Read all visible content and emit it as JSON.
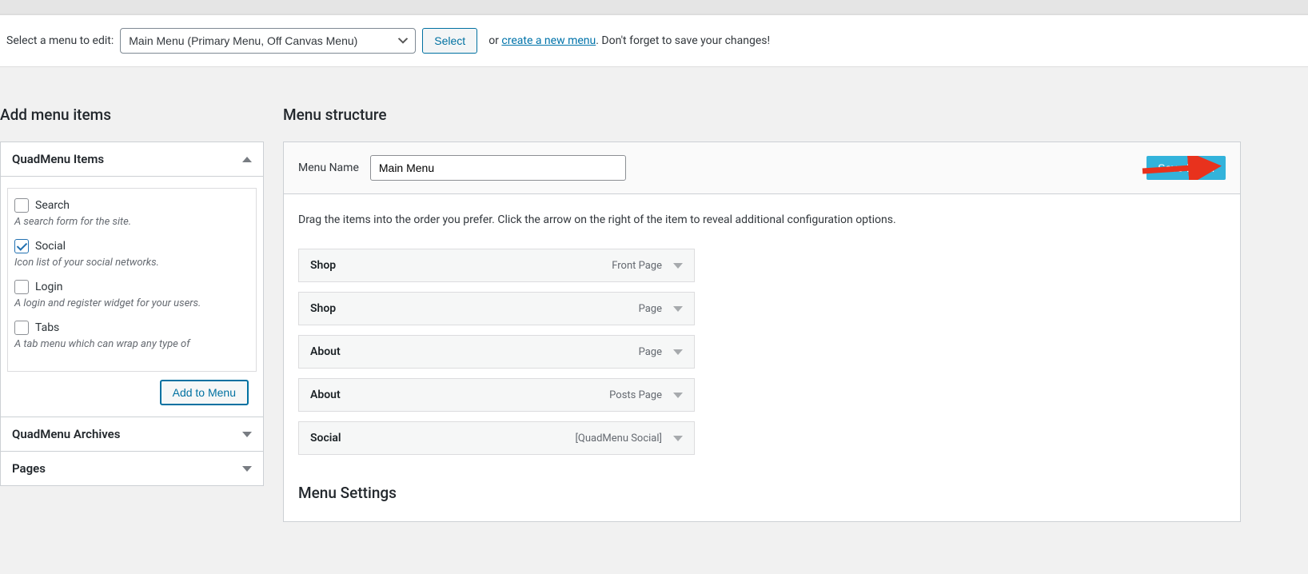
{
  "selectBar": {
    "label": "Select a menu to edit:",
    "selectedOption": "Main Menu (Primary Menu, Off Canvas Menu)",
    "selectButton": "Select",
    "orText": "or ",
    "createLink": "create a new menu",
    "tailText": ". Don't forget to save your changes!"
  },
  "leftPanel": {
    "heading": "Add menu items",
    "quadmenuItems": {
      "title": "QuadMenu Items",
      "items": [
        {
          "label": "Search",
          "desc": "A search form for the site.",
          "checked": false
        },
        {
          "label": "Social",
          "desc": "Icon list of your social networks.",
          "checked": true
        },
        {
          "label": "Login",
          "desc": "A login and register widget for your users.",
          "checked": false
        },
        {
          "label": "Tabs",
          "desc": "A tab menu which can wrap any type of",
          "checked": false
        }
      ],
      "addButton": "Add to Menu"
    },
    "archives": {
      "title": "QuadMenu Archives"
    },
    "pages": {
      "title": "Pages"
    }
  },
  "rightPanel": {
    "heading": "Menu structure",
    "menuNameLabel": "Menu Name",
    "menuNameValue": "Main Menu",
    "saveButton": "Save Menu",
    "dragHelp": "Drag the items into the order you prefer. Click the arrow on the right of the item to reveal additional configuration options.",
    "menuItems": [
      {
        "title": "Shop",
        "type": "Front Page"
      },
      {
        "title": "Shop",
        "type": "Page"
      },
      {
        "title": "About",
        "type": "Page"
      },
      {
        "title": "About",
        "type": "Posts Page"
      },
      {
        "title": "Social",
        "type": "[QuadMenu Social]"
      }
    ],
    "settingsHeading": "Menu Settings"
  }
}
